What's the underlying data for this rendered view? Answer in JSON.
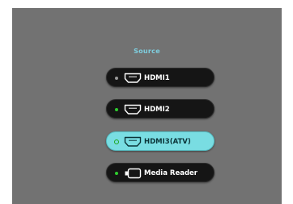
{
  "menu": {
    "title": "Source",
    "title_color": "#7ecfe0",
    "items": [
      {
        "label": "HDMI1",
        "icon": "hdmi-connector-icon",
        "status": "inactive",
        "indicator_color": "#9a9a9a",
        "selected": false
      },
      {
        "label": "HDMI2",
        "icon": "hdmi-connector-icon",
        "status": "active",
        "indicator_color": "#2ecc2e",
        "selected": false
      },
      {
        "label": "HDMI3(ATV)",
        "icon": "hdmi-connector-icon",
        "status": "active",
        "indicator_color": "#1ba61b",
        "selected": true
      },
      {
        "label": "Media Reader",
        "icon": "usb-connector-icon",
        "status": "active",
        "indicator_color": "#2ecc2e",
        "selected": false
      }
    ],
    "selected_color": "#79dde2"
  }
}
